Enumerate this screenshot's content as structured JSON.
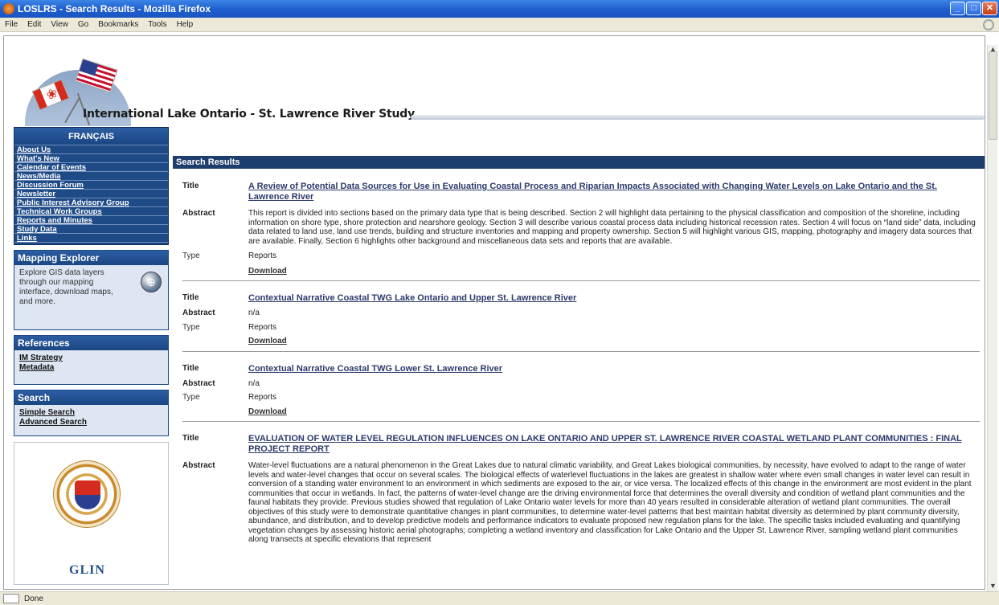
{
  "window": {
    "title": "LOSLRS - Search Results - Mozilla Firefox"
  },
  "menu": [
    "File",
    "Edit",
    "View",
    "Go",
    "Bookmarks",
    "Tools",
    "Help"
  ],
  "header": {
    "study_title": "International Lake Ontario - St. Lawrence River Study"
  },
  "sidebar": {
    "lang_link": "FRANÇAIS",
    "nav": [
      "About Us",
      "What's New",
      "Calendar of Events",
      "News/Media",
      "Discussion Forum",
      "Newsletter",
      "Public Interest Advisory Group",
      "Technical Work Groups",
      "Reports and Minutes",
      "Study Data",
      "Links"
    ],
    "mapping": {
      "heading": "Mapping Explorer",
      "text": "Explore GIS data layers through our mapping interface, download maps, and more."
    },
    "references": {
      "heading": "References",
      "links": [
        "IM Strategy",
        "Metadata"
      ]
    },
    "search": {
      "heading": "Search",
      "links": [
        "Simple Search",
        "Advanced Search"
      ]
    },
    "logo_text": "GLIN"
  },
  "main": {
    "heading": "Search Results",
    "labels": {
      "title": "Title",
      "abstract": "Abstract",
      "type": "Type",
      "download": "Download"
    },
    "results": [
      {
        "title": "A Review of Potential Data Sources for Use in Evaluating Coastal Process and Riparian Impacts Associated with Changing Water Levels on Lake Ontario and the St. Lawrence River",
        "abstract": "This report is divided into sections based on the primary data type that is being described. Section 2 will highlight data pertaining to the physical classification and composition of the shoreline, including information on shore type, shore protection and nearshore geology. Section 3 will describe various coastal process data including historical recession rates. Section 4 will focus on “land side” data, including data related to land use, land use trends, building and structure inventories and mapping and property ownership. Section 5 will highlight various GIS, mapping, photography and imagery data sources that are available. Finally, Section 6 highlights other background and miscellaneous data sets and reports that are available.",
        "type": "Reports"
      },
      {
        "title": "Contextual Narrative Coastal TWG Lake Ontario and Upper St. Lawrence River",
        "abstract": "n/a",
        "type": "Reports"
      },
      {
        "title": "Contextual Narrative Coastal TWG Lower St. Lawrence River",
        "abstract": "n/a",
        "type": "Reports"
      },
      {
        "title": "EVALUATION OF WATER LEVEL REGULATION INFLUENCES ON LAKE ONTARIO AND UPPER ST. LAWRENCE RIVER COASTAL WETLAND PLANT COMMUNITIES : FINAL PROJECT REPORT",
        "abstract": "Water-level fluctuations are a natural phenomenon in the Great Lakes due to natural climatic variability, and Great Lakes biological communities, by necessity, have evolved to adapt to the range of water levels and water-level changes that occur on several scales. The biological effects of waterlevel fluctuations in the lakes are greatest in shallow water where even small changes in water level can result in conversion of a standing water environment to an environment in which sediments are exposed to the air, or vice versa. The localized effects of this change in the environment are most evident in the plant communities that occur in wetlands. In fact, the patterns of water-level change are the driving environmental force that determines the overall diversity and condition of wetland plant communities and the faunal habitats they provide. Previous studies showed that regulation of Lake Ontario water levels for more than 40 years resulted in considerable alteration of wetland plant communities. The overall objectives of this study were to demonstrate quantitative changes in plant communities, to determine water-level patterns that best maintain habitat diversity as determined by plant community diversity, abundance, and distribution, and to develop predictive models and performance indicators to evaluate proposed new regulation plans for the lake. The specific tasks included evaluating and quantifying vegetation changes by assessing historic aerial photographs; completing a wetland inventory and classification for Lake Ontario and the Upper St. Lawrence River, sampling wetland plant communities along transects at specific elevations that represent"
      }
    ]
  },
  "status": {
    "text": "Done"
  }
}
